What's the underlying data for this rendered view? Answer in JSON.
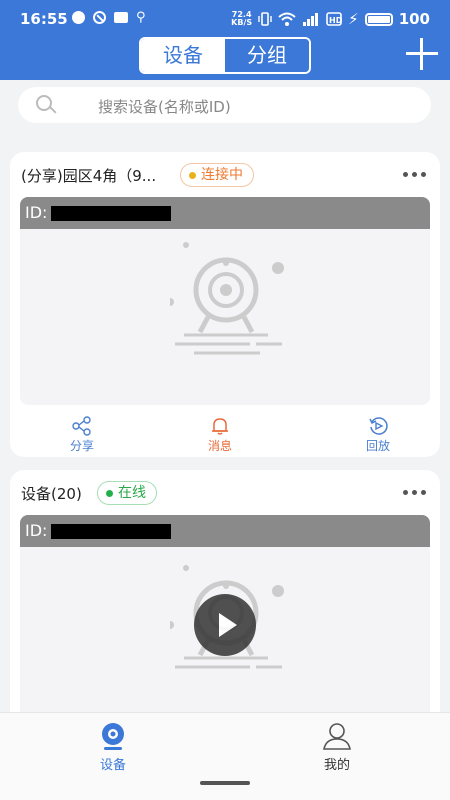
{
  "status_bar": {
    "time": "16:55",
    "net_speed_top": "72.4",
    "net_speed_bottom": "KB/S",
    "battery": "100"
  },
  "header": {
    "tabs": [
      {
        "label": "设备",
        "active": true
      },
      {
        "label": "分组",
        "active": false
      }
    ],
    "add_icon": "plus-icon",
    "accent_color": "#3b78d8"
  },
  "search": {
    "placeholder": "搜索设备(名称或ID)"
  },
  "devices": [
    {
      "name": "(分享)园区4角（9...",
      "status": "连接中",
      "status_color": "#f07a30",
      "id_label": "ID:",
      "has_play_button": false,
      "actions": [
        {
          "label": "分享",
          "icon": "share-icon"
        },
        {
          "label": "消息",
          "icon": "bell-icon"
        },
        {
          "label": "回放",
          "icon": "replay-icon"
        }
      ]
    },
    {
      "name": "设备(20)",
      "status": "在线",
      "status_color": "#2aa84a",
      "id_label": "ID:",
      "has_play_button": true
    }
  ],
  "bottom_nav": [
    {
      "label": "设备",
      "icon": "camera-icon",
      "active": true
    },
    {
      "label": "我的",
      "icon": "person-icon",
      "active": false
    }
  ]
}
